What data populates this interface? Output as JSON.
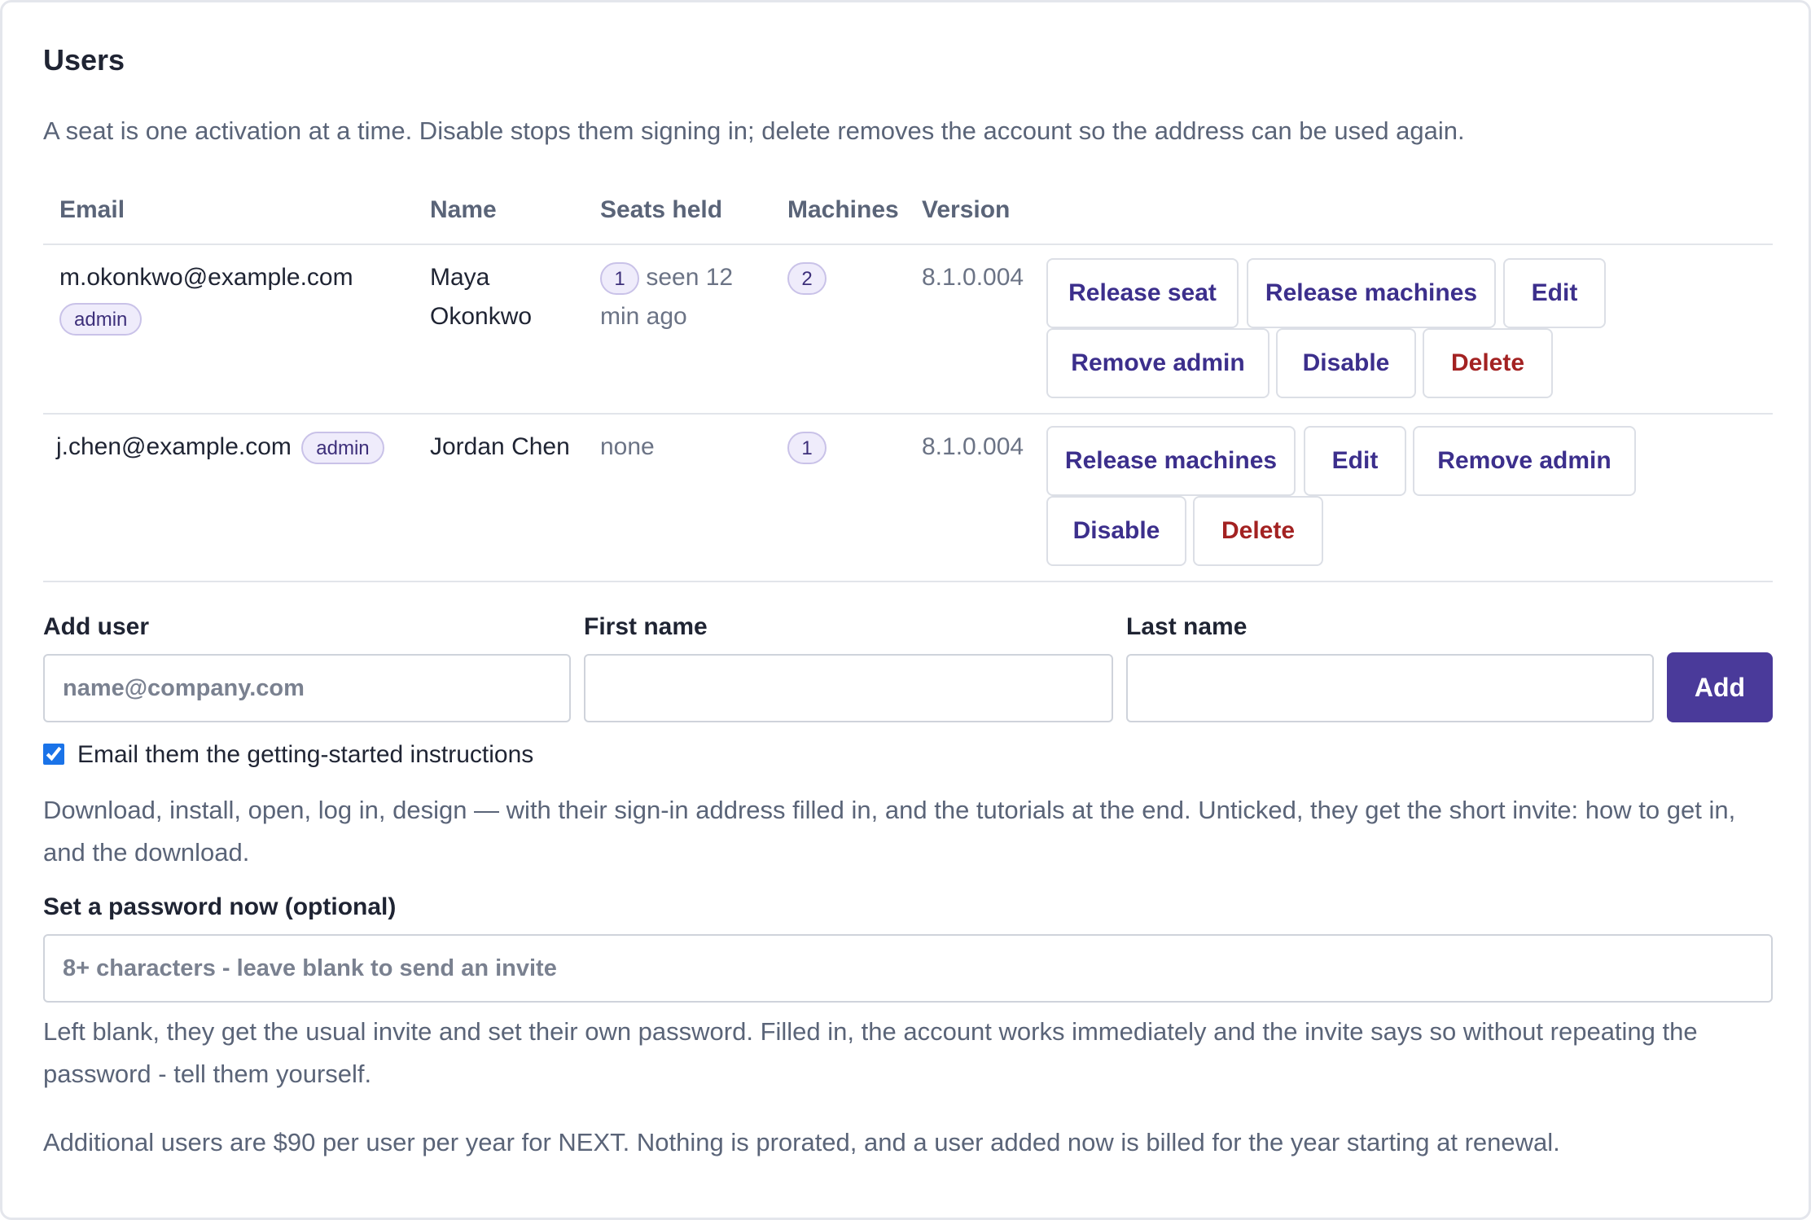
{
  "users": {
    "title": "Users",
    "intro": "A seat is one activation at a time. Disable stops them signing in; delete removes the account so the address can be used again.",
    "columns": [
      "Email",
      "Name",
      "Seats held",
      "Machines",
      "Version"
    ],
    "rows": [
      {
        "email": "m.okonkwo@example.com",
        "role_badge": "admin",
        "name_line1": "Maya",
        "name_line2": "Okonkwo",
        "seats_count": "1",
        "seats_text_line1": "seen 12",
        "seats_text_line2": "min ago",
        "machines": "2",
        "version": "8.1.0.004",
        "actions": [
          "Release seat",
          "Release machines",
          "Edit",
          "Remove admin",
          "Disable",
          "Delete"
        ]
      },
      {
        "email": "j.chen@example.com",
        "role_badge": "admin",
        "name": "Jordan Chen",
        "seats_text": "none",
        "machines": "1",
        "version": "8.1.0.004",
        "actions": [
          "Release machines",
          "Edit",
          "Remove admin",
          "Disable",
          "Delete"
        ]
      }
    ]
  },
  "add_user": {
    "email_label": "Add user",
    "email_placeholder": "name@company.com",
    "first_name_label": "First name",
    "last_name_label": "Last name",
    "add_button": "Add",
    "send_instructions_checked": true,
    "send_instructions_label": "Email them the getting-started instructions",
    "instructions_help": "Download, install, open, log in, design — with their sign-in address filled in, and the tutorials at the end. Unticked, they get the short invite: how to get in, and the download.",
    "password_label": "Set a password now (optional)",
    "password_placeholder": "8+ characters - leave blank to send an invite",
    "password_help": "Left blank, they get the usual invite and set their own password. Filled in, the account works immediately and the invite says so without repeating the password - tell them yourself.",
    "billing_note": "Additional users are $90 per user per year for NEXT. Nothing is prorated, and a user added now is billed for the year starting at renewal."
  },
  "colors": {
    "accent": "#4a3a9a",
    "danger": "#a32222",
    "badge_bg": "#efecfb"
  }
}
